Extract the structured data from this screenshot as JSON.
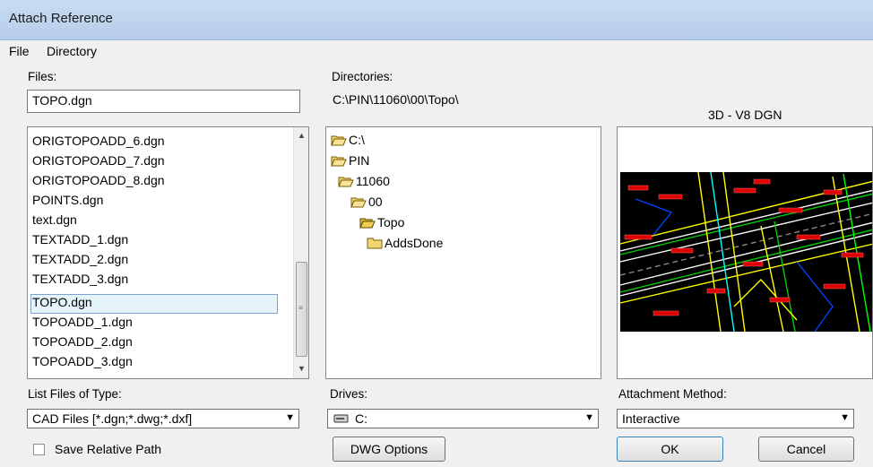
{
  "window": {
    "title": "Attach Reference"
  },
  "menu": {
    "file": "File",
    "directory": "Directory"
  },
  "files": {
    "label": "Files:",
    "value": "TOPO.dgn",
    "items": [
      "ORIGTOPOADD_6.dgn",
      "ORIGTOPOADD_7.dgn",
      "ORIGTOPOADD_8.dgn",
      "POINTS.dgn",
      "text.dgn",
      "TEXTADD_1.dgn",
      "TEXTADD_2.dgn",
      "TEXTADD_3.dgn",
      "TOPO.dgn",
      "TOPOADD_1.dgn",
      "TOPOADD_2.dgn",
      "TOPOADD_3.dgn"
    ],
    "selected": "TOPO.dgn"
  },
  "directories": {
    "label": "Directories:",
    "path": "C:\\PIN\\11060\\00\\Topo\\",
    "tree": [
      "C:\\",
      "PIN",
      "11060",
      "00",
      "Topo",
      "AddsDone"
    ]
  },
  "preview": {
    "format": "3D - V8 DGN"
  },
  "file_type": {
    "label": "List Files of Type:",
    "value": "CAD Files [*.dgn;*.dwg;*.dxf]"
  },
  "drives": {
    "label": "Drives:",
    "value": "C:"
  },
  "attachment": {
    "label": "Attachment Method:",
    "value": "Interactive"
  },
  "options": {
    "save_relative_path": "Save Relative Path",
    "save_relative_checked": false
  },
  "buttons": {
    "dwg_options": "DWG Options",
    "ok": "OK",
    "cancel": "Cancel"
  },
  "colors": {
    "selection": "#e5f3fb",
    "titlebar": "#c9dcf2",
    "folder": "#f2d675"
  }
}
